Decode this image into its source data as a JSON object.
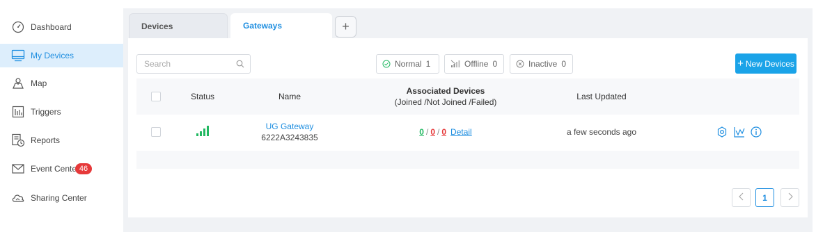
{
  "sidebar": {
    "items": [
      {
        "label": "Dashboard",
        "icon": "dashboard-gauge-icon"
      },
      {
        "label": "My Devices",
        "icon": "monitor-icon",
        "active": true
      },
      {
        "label": "Map",
        "icon": "map-icon"
      },
      {
        "label": "Triggers",
        "icon": "triggers-icon"
      },
      {
        "label": "Reports",
        "icon": "reports-icon"
      },
      {
        "label": "Event Center",
        "icon": "envelope-icon",
        "badge": "46"
      },
      {
        "label": "Sharing Center",
        "icon": "cloud-share-icon"
      }
    ]
  },
  "tabs": [
    {
      "label": "Devices",
      "active": false
    },
    {
      "label": "Gateways",
      "active": true
    }
  ],
  "toolbar": {
    "search_placeholder": "Search",
    "filters": [
      {
        "label": "Normal",
        "count": "1",
        "icon": "check-circle-icon"
      },
      {
        "label": "Offline",
        "count": "0",
        "icon": "signal-off-icon"
      },
      {
        "label": "Inactive",
        "count": "0",
        "icon": "x-circle-icon"
      }
    ],
    "new_button_label": "New Devices"
  },
  "table": {
    "headers": {
      "status": "Status",
      "name": "Name",
      "associated_line1": "Associated Devices",
      "associated_line2": "(Joined /Not Joined /Failed)",
      "last_updated": "Last Updated"
    },
    "rows": [
      {
        "status": "online",
        "name": "UG Gateway",
        "serial": "6222A3243835",
        "joined": "0",
        "not_joined": "0",
        "failed": "0",
        "detail_label": "Detail",
        "last_updated": "a few seconds ago",
        "actions": [
          "settings-icon",
          "chart-icon",
          "info-icon"
        ]
      }
    ]
  },
  "pagination": {
    "current_page": "1"
  },
  "colors": {
    "accent": "#1e8ee0",
    "button": "#1aa3e8",
    "badge": "#e6393a",
    "online": "#21b861"
  }
}
